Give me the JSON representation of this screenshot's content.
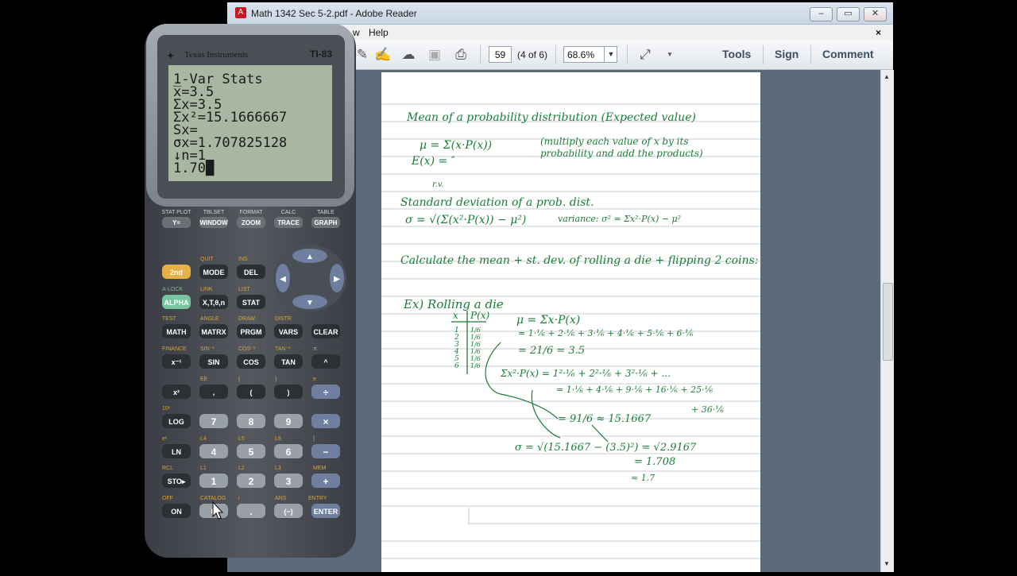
{
  "window": {
    "title": "Math 1342 Sec 5-2.pdf - Adobe Reader",
    "menu": {
      "help": "Help",
      "partial": "w"
    },
    "close_x": "×"
  },
  "toolbar": {
    "page_number": "59",
    "page_of": "(4 of 6)",
    "zoom": "68.6%",
    "tools": "Tools",
    "sign": "Sign",
    "comment": "Comment"
  },
  "calculator": {
    "brand": "Texas Instruments",
    "model": "TI-83",
    "screen_lines": [
      "1-Var Stats",
      " x̅=3.5",
      " Σx=3.5",
      " Σx²=15.1666667",
      " Sx=",
      " σx=1.707825128",
      "↓n=1",
      "1.70█"
    ],
    "function_labels": [
      "STAT PLOT",
      "TBLSET",
      "FORMAT",
      "CALC",
      "TABLE"
    ],
    "function_keys": [
      "Y=",
      "WINDOW",
      "ZOOM",
      "TRACE",
      "GRAPH"
    ]
  },
  "notes": {
    "title": "Mean of a probability distribution (Expected value)",
    "mu_formula": "μ = Σ(x·P(x))",
    "ex_formula": "E(x) = ″",
    "rv": "r.v.",
    "multiply_note": "(multiply each value of x by its probability and add the products)",
    "sd_title": "Standard deviation of a prob. dist.",
    "sd_formula": "σ = √(Σ(x²·P(x)) − μ²)",
    "variance": "variance: σ² = Σx²·P(x) − μ²",
    "calc_instruction": "Calculate the mean + st. dev. of rolling a die + flipping 2 coins:",
    "example": "Ex) Rolling a die",
    "col_x": "x",
    "col_px": "P(x)",
    "x_values": [
      "1",
      "2",
      "3",
      "4",
      "5",
      "6"
    ],
    "px_values": [
      "1/6",
      "1/6",
      "1/6",
      "1/6",
      "1/6",
      "1/6"
    ],
    "mean_line1": "μ = Σx·P(x)",
    "mean_line2": "= 1·⅙ + 2·⅙ + 3·⅙ + 4·⅙ + 5·⅙ + 6·⅙",
    "mean_line3": "= 21/6 = 3.5",
    "sq_line1": "Σx²·P(x) = 1²·⅙ + 2²·⅙ + 3²·⅙ + ...",
    "sq_line2": "= 1·⅙ + 4·⅙ + 9·⅙ + 16·⅙ + 25·⅙",
    "sq_line3": "+ 36·⅙",
    "sq_result": "= 91/6 ≈ 15.1667",
    "sigma_line1": "σ = √(15.1667 − (3.5)²) = √2.9167",
    "sigma_line2": "= 1.708",
    "sigma_line3": "≈ 1.7"
  }
}
